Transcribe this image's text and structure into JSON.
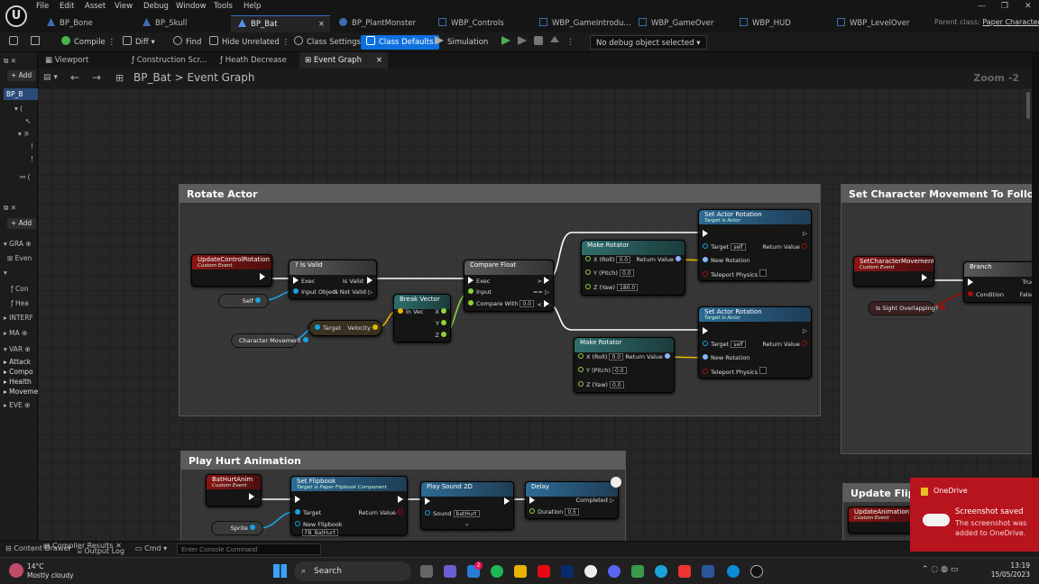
{
  "menu": [
    "File",
    "Edit",
    "Asset",
    "View",
    "Debug",
    "Window",
    "Tools",
    "Help"
  ],
  "tabs": [
    {
      "label": "BP_Bone",
      "active": false
    },
    {
      "label": "BP_Skull",
      "active": false
    },
    {
      "label": "BP_Bat",
      "active": true
    },
    {
      "label": "BP_PlantMonster",
      "active": false
    },
    {
      "label": "WBP_Controls",
      "active": false
    },
    {
      "label": "WBP_GameIntrodu...",
      "active": false
    },
    {
      "label": "WBP_GameOver",
      "active": false
    },
    {
      "label": "WBP_HUD",
      "active": false
    },
    {
      "label": "WBP_LevelOver",
      "active": false
    }
  ],
  "tab_close": "×",
  "parent_class": {
    "label": "Parent class:",
    "value": "Paper Character"
  },
  "window_buttons": {
    "min": "—",
    "max": "❐",
    "close": "✕"
  },
  "toolbar": {
    "compile": "Compile",
    "diff": "Diff",
    "find": "Find",
    "hide_unrelated": "Hide Unrelated",
    "class_settings": "Class Settings",
    "class_defaults": "Class Defaults",
    "simulation": "Simulation",
    "debug_object": "No debug object selected"
  },
  "left_panel": {
    "add": "+ Add",
    "root": "BP_B",
    "add2": "+ Add",
    "sections": [
      "GRA",
      "Even",
      "Con",
      "Hea",
      "INTERF",
      "MA",
      "VAR"
    ],
    "var_items": [
      "Attack",
      "Compo",
      "Health",
      "Moveme"
    ],
    "eve": "EVE"
  },
  "editor_tabs": [
    "Viewport",
    "Construction Scr...",
    "Heath Decrease",
    "Event Graph"
  ],
  "breadcrumb": {
    "root": "BP_Bat",
    "sep": ">",
    "graph": "Event Graph"
  },
  "zoom": "Zoom -2",
  "comments": {
    "rotate": "Rotate Actor",
    "follow": "Set Character Movement To Follow Chara",
    "hurt": "Play Hurt Animation",
    "flipbook": "Update FlipBo"
  },
  "nodes": {
    "update_rotation": {
      "title": "UpdateControlRotation",
      "sub": "Custom Event"
    },
    "self": "Self",
    "is_valid": {
      "title": "? Is Valid",
      "exec": "Exec",
      "is_valid": "Is Valid",
      "input_object": "Input Object",
      "is_not_valid": "Is Not Valid"
    },
    "char_movement": "Character Movement",
    "get_velocity": {
      "target": "Target",
      "velocity": "Velocity"
    },
    "break_vector": {
      "title": "Break Vector",
      "in_vec": "In Vec",
      "x": "X",
      "y": "Y",
      "z": "Z"
    },
    "compare_float": {
      "title": "Compare Float",
      "exec": "Exec",
      "input": "Input",
      "compare_with": "Compare With",
      "cw_val": "0.0",
      "gt": ">",
      "eq": "==",
      "lt": "<"
    },
    "make_rot1": {
      "title": "Make Rotator",
      "roll": "X (Roll)",
      "roll_v": "0.0",
      "pitch": "Y (Pitch)",
      "pitch_v": "0.0",
      "yaw": "Z (Yaw)",
      "yaw_v": "180.0",
      "ret": "Return Value"
    },
    "make_rot2": {
      "title": "Make Rotator",
      "roll": "X (Roll)",
      "roll_v": "0.0",
      "pitch": "Y (Pitch)",
      "pitch_v": "0.0",
      "yaw": "Z (Yaw)",
      "yaw_v": "0.0",
      "ret": "Return Value"
    },
    "set_rot1": {
      "title": "Set Actor Rotation",
      "sub": "Target is Actor",
      "target": "Target",
      "target_v": "self",
      "ret": "Return Value",
      "new_rot": "New Rotation",
      "teleport": "Teleport Physics"
    },
    "set_rot2": {
      "title": "Set Actor Rotation",
      "sub": "Target is Actor",
      "target": "Target",
      "target_v": "self",
      "ret": "Return Value",
      "new_rot": "New Rotation",
      "teleport": "Teleport Physics"
    },
    "set_char_mov": {
      "title": "SetCharacterMovement",
      "sub": "Custom Event"
    },
    "is_sight": "Is Sight Overlapping?",
    "branch": {
      "title": "Branch",
      "cond": "Condition",
      "t": "True",
      "f": "False"
    },
    "bat_hurt": {
      "title": "BatHurtAnim",
      "sub": "Custom Event"
    },
    "set_flipbook": {
      "title": "Set Flipbook",
      "sub": "Target is Paper Flipbook Component",
      "target": "Target",
      "ret": "Return Value",
      "new_fb": "New Flipbook",
      "fb_v": "FB_BatHurt"
    },
    "sprite": "Sprite",
    "play_sound": {
      "title": "Play Sound 2D",
      "sound": "Sound",
      "sound_v": "batHurt"
    },
    "delay": {
      "title": "Delay",
      "completed": "Completed",
      "duration": "Duration",
      "dur_v": "0.5"
    },
    "update_anim": {
      "title": "UpdateAnimation",
      "sub": "Custom Event"
    }
  },
  "bottom": {
    "content_drawer": "Content Drawer",
    "output_log": "Output Log",
    "cmd": "Cmd",
    "console_placeholder": "Enter Console Command",
    "compiler_results": "Compiler Results"
  },
  "taskbar": {
    "temp": "14°C",
    "weather": "Mostly cloudy",
    "search": "Search",
    "time": "13:19",
    "date": "15/05/2023",
    "badge": "2"
  },
  "toast": {
    "app": "OneDrive",
    "title": "Screenshot saved",
    "body": "The screenshot was added to OneDrive."
  },
  "colors": {
    "accent": "#0e70e0",
    "event_red": "#8b1414",
    "function_blue": "#2d6b95",
    "toast_red": "#b8141e"
  }
}
